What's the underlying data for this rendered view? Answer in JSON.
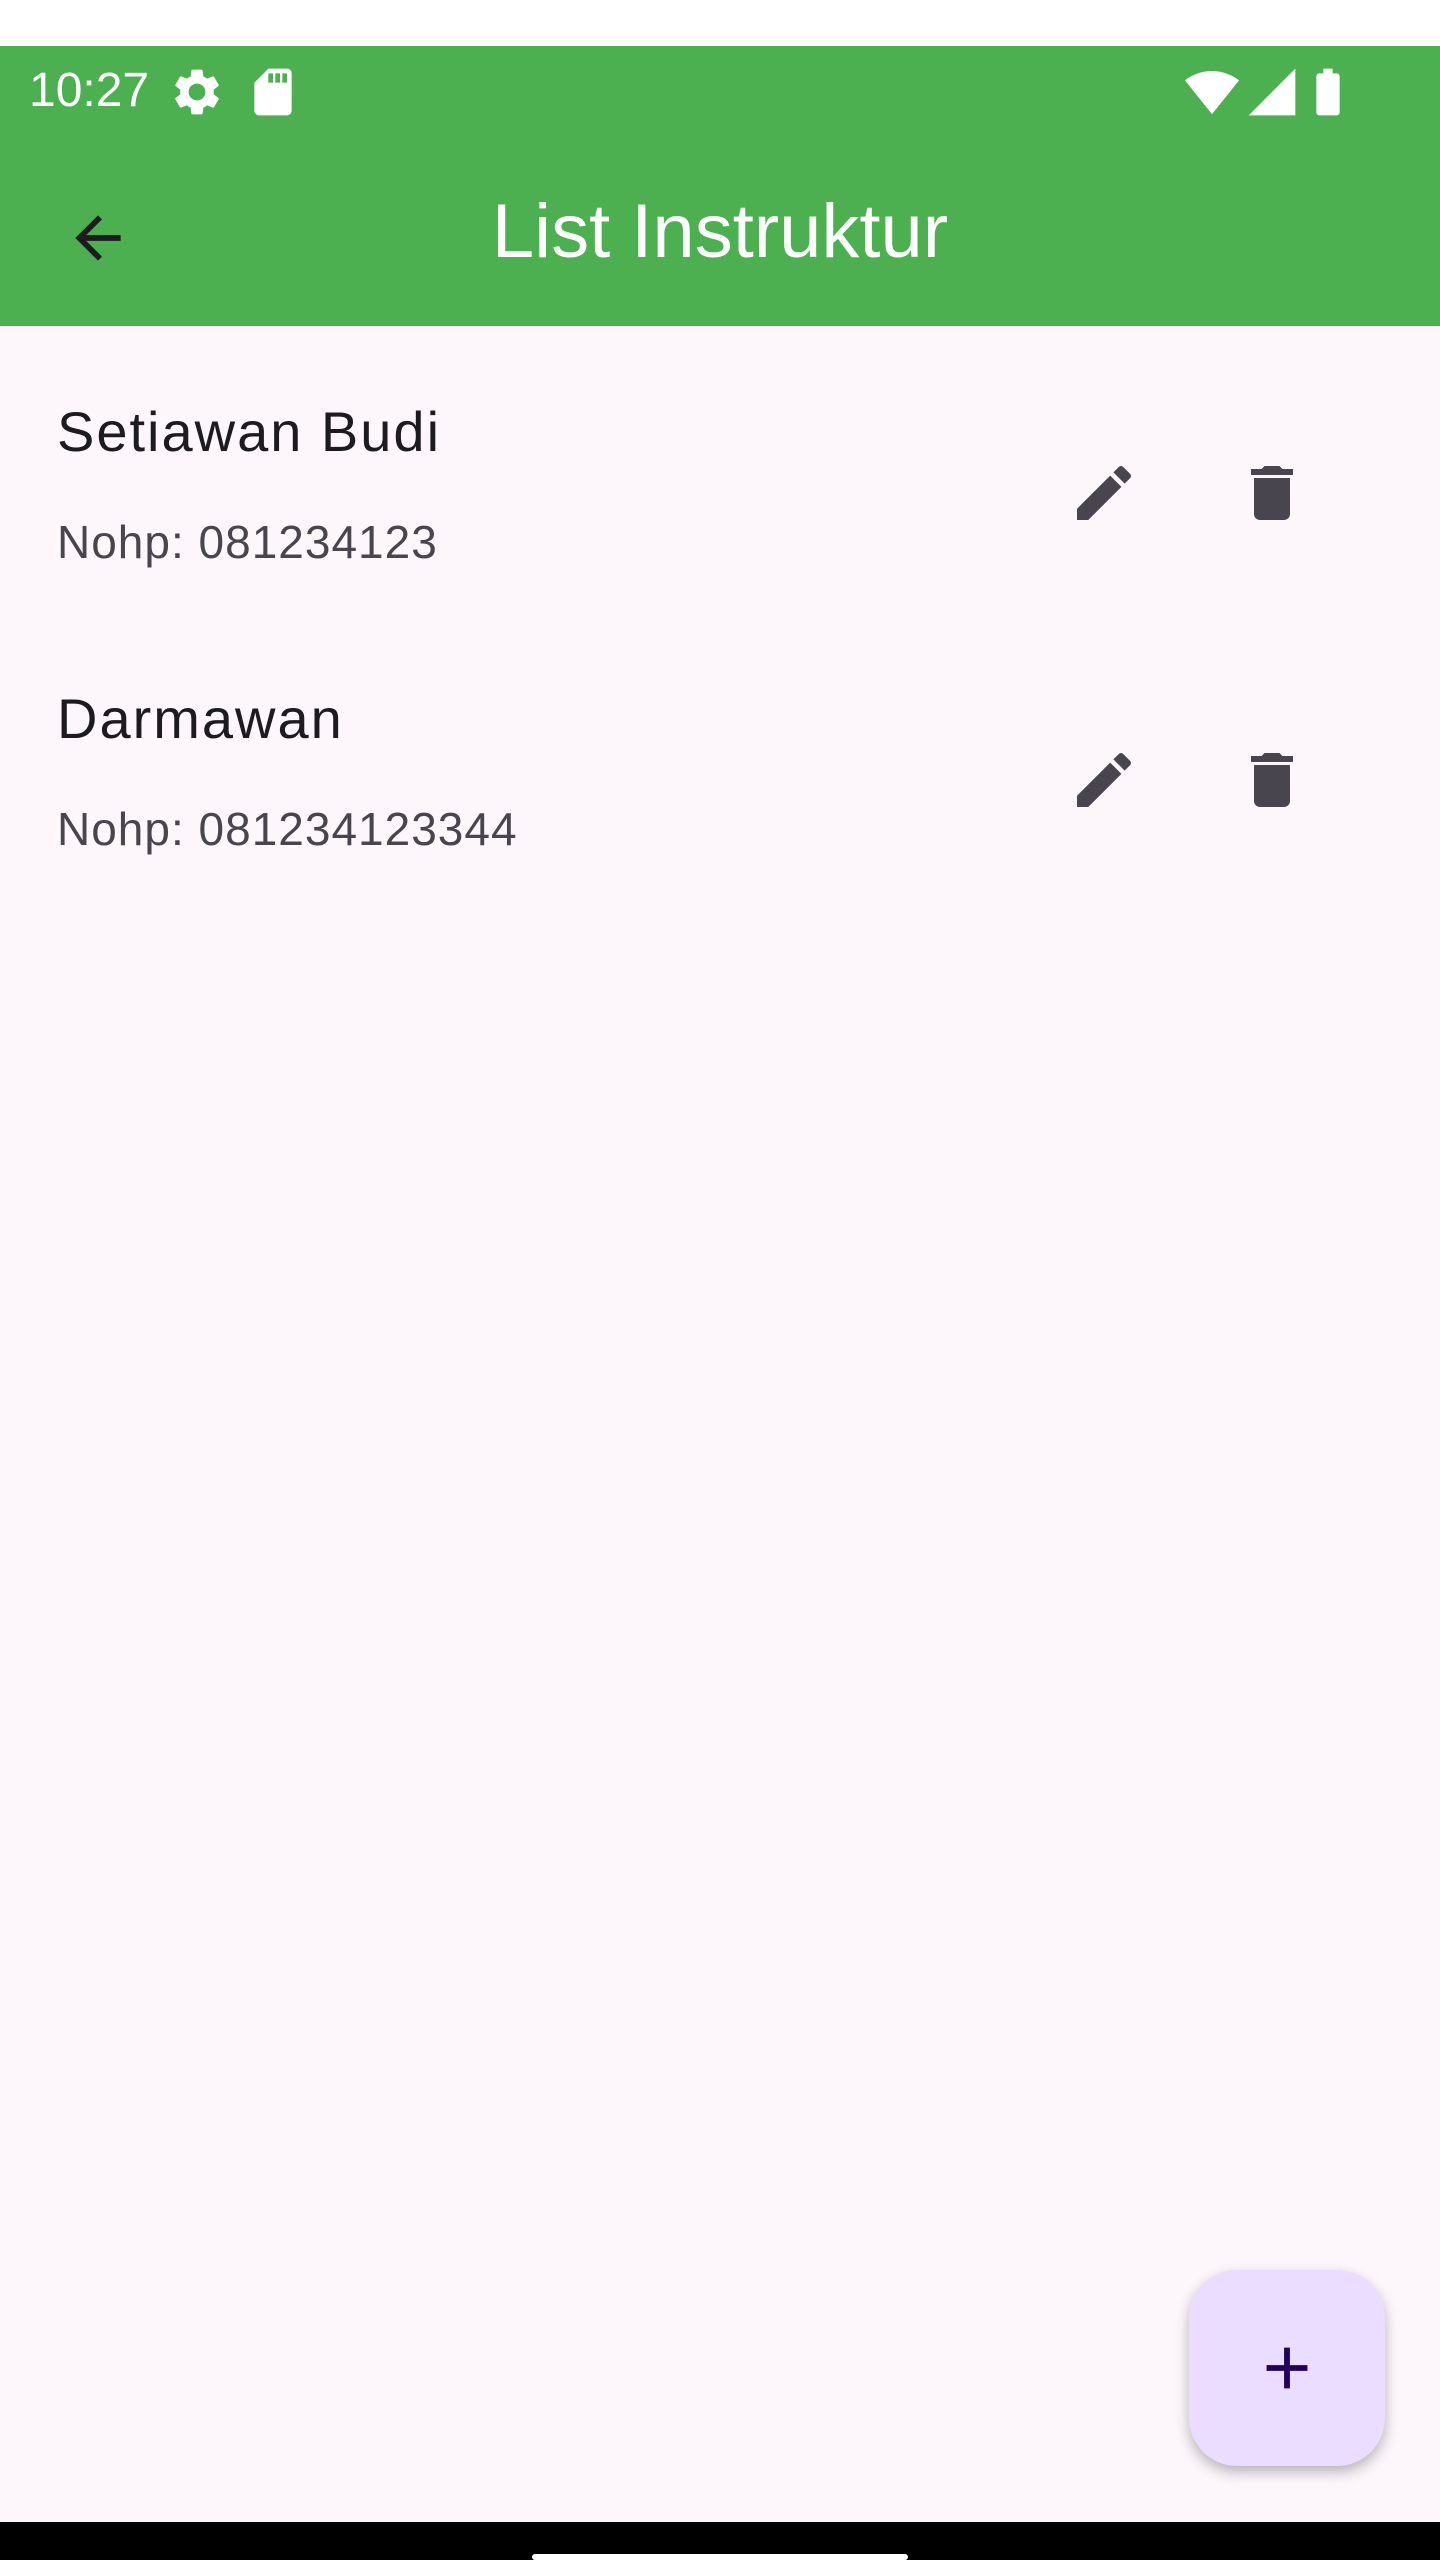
{
  "status_bar": {
    "time": "10:27",
    "left_icons": [
      "settings-icon",
      "sd-card-icon"
    ],
    "right_icons": [
      "wifi-icon",
      "cell-signal-icon",
      "battery-icon"
    ]
  },
  "header": {
    "title": "List Instruktur",
    "background_color": "#4caf50",
    "back_icon": "arrow-back-icon"
  },
  "instructors": [
    {
      "name": "Setiawan Budi",
      "phone": "Nohp: 081234123"
    },
    {
      "name": "Darmawan",
      "phone": "Nohp: 081234123344"
    }
  ],
  "item_actions": {
    "edit_icon": "pencil-icon",
    "delete_icon": "trash-icon"
  },
  "fab": {
    "icon": "plus-icon",
    "background_color": "#eaddff"
  },
  "colors": {
    "page_background": "#fdf7fb",
    "icon_color": "#49454f",
    "title_text": "#ffffff"
  }
}
